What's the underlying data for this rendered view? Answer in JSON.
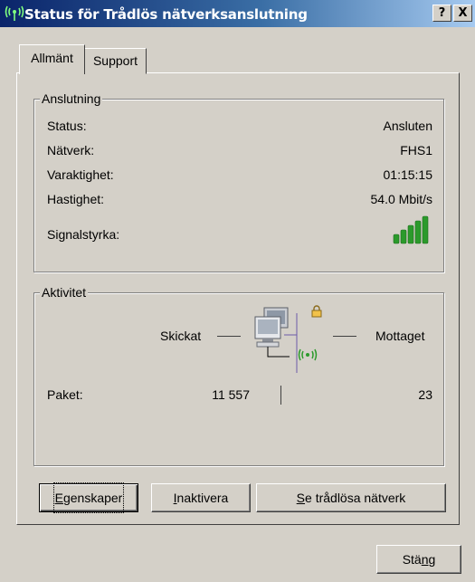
{
  "window": {
    "title": "Status för Trådlös nätverksanslutning",
    "help_label": "?",
    "close_label": "X"
  },
  "tabs": [
    {
      "label": "Allmänt",
      "active": true
    },
    {
      "label": "Support",
      "active": false
    }
  ],
  "connection": {
    "group_label": "Anslutning",
    "rows": [
      {
        "label": "Status:",
        "value": "Ansluten"
      },
      {
        "label": "Nätverk:",
        "value": "FHS1"
      },
      {
        "label": "Varaktighet:",
        "value": "01:15:15"
      },
      {
        "label": "Hastighet:",
        "value": "54.0 Mbit/s"
      }
    ],
    "signal_label": "Signalstyrka:",
    "signal_bars_lit": 5,
    "signal_bars_total": 5,
    "signal_color": "#2b9a2b"
  },
  "activity": {
    "group_label": "Aktivitet",
    "sent_label": "Skickat",
    "received_label": "Mottaget",
    "packets_label": "Paket:",
    "packets_sent": "11 557",
    "packets_received": "23"
  },
  "buttons": {
    "properties": {
      "pre": "",
      "key": "E",
      "post": "genskaper"
    },
    "disable": {
      "pre": "",
      "key": "I",
      "post": "naktivera"
    },
    "view_networks": {
      "pre": "",
      "key": "S",
      "post": "e trådlösa nätverk"
    },
    "close": {
      "pre": "Stä",
      "key": "n",
      "post": "g"
    }
  },
  "colors": {
    "titlebar_start": "#0a246a",
    "titlebar_end": "#a6caf0",
    "face": "#d4d0c8",
    "accent_green": "#2b9a2b"
  },
  "icons": {
    "title": "wireless-network-icon",
    "network": "network-computers-icon",
    "lock": "lock-icon",
    "wireless": "wireless-signal-icon"
  }
}
